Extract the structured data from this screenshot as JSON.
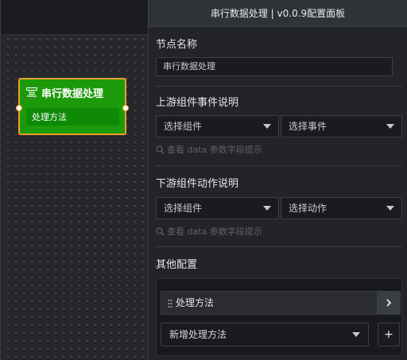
{
  "canvas": {
    "node": {
      "title": "串行数据处理",
      "icon": "serial-processing-icon",
      "method_label": "处理方法",
      "header_color": "#1c9a0a",
      "border_color": "#f3a02a"
    }
  },
  "panel": {
    "title": "串行数据处理 | v0.0.9配置面板",
    "node_name": {
      "label": "节点名称",
      "value": "串行数据处理"
    },
    "upstream": {
      "label": "上游组件事件说明",
      "component_select": "选择组件",
      "event_select": "选择事件",
      "hint_icon": "search-icon",
      "hint": "查看 data 参数字段提示"
    },
    "downstream": {
      "label": "下游组件动作说明",
      "component_select": "选择组件",
      "action_select": "选择动作",
      "hint_icon": "search-icon",
      "hint": "查看 data 参数字段提示"
    },
    "other": {
      "label": "其他配置",
      "method_item": "处理方法",
      "expand_icon": "chevron-right-icon",
      "add_method_select": "新增处理方法",
      "add_button": "+"
    }
  }
}
